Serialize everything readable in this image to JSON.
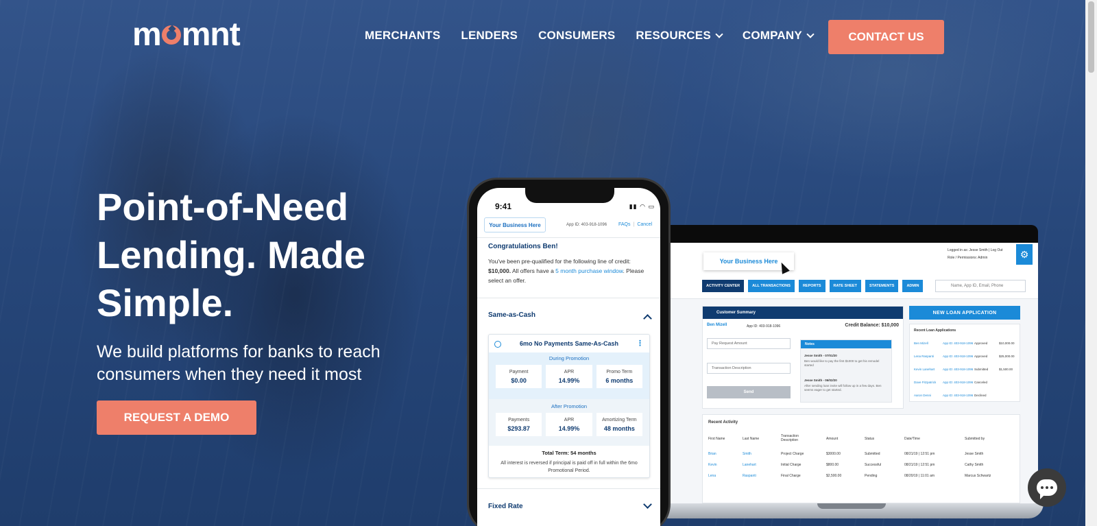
{
  "brand": {
    "logo_text": "momnt",
    "accent": "#ee7f6a",
    "navy": "#0f3b70",
    "blue": "#1b8ad8"
  },
  "nav": {
    "items": [
      {
        "label": "MERCHANTS",
        "dropdown": false
      },
      {
        "label": "LENDERS",
        "dropdown": false
      },
      {
        "label": "CONSUMERS",
        "dropdown": false
      },
      {
        "label": "RESOURCES",
        "dropdown": true
      },
      {
        "label": "COMPANY",
        "dropdown": true
      }
    ],
    "cta": "CONTACT US"
  },
  "hero": {
    "headline": "Point-of-Need Lending. Made Simple.",
    "subhead": "We build platforms for banks to reach consumers when they need it most",
    "cta": "REQUEST A DEMO"
  },
  "phone": {
    "time": "9:41",
    "business": "Your Business Here",
    "app_id": "App ID: 403-918-1096",
    "faqs": "FAQs",
    "cancel": "Cancel",
    "congrats": "Congratulations Ben!",
    "body_1": "You've been pre-qualified for the following line of credit:",
    "amount": "$10,000.",
    "body_2": "All offers have a",
    "window": "5 month purchase window",
    "body_3": ". Please select an offer.",
    "section_1": "Same-as-Cash",
    "offer_title": "6mo No Payments Same-As-Cash",
    "during_label": "During Promotion",
    "during": [
      {
        "label": "Payment",
        "value": "$0.00"
      },
      {
        "label": "APR",
        "value": "14.99%"
      },
      {
        "label": "Promo Term",
        "value": "6 months"
      }
    ],
    "after_label": "After Promotion",
    "after": [
      {
        "label": "Payments",
        "value": "$293.87"
      },
      {
        "label": "APR",
        "value": "14.99%"
      },
      {
        "label": "Amortizing Term",
        "value": "48 months"
      }
    ],
    "total_term": "Total Term: 54 months",
    "fine_print": "All interest is reversed if principal is paid off in full within the 6mo Promotional Period.",
    "section_2": "Fixed Rate"
  },
  "laptop": {
    "business": "Your Business Here",
    "logged_in": "Logged in as: Jesse Smith | Log Out",
    "role": "Role / Permissions: Admin",
    "tabs": [
      "ACTIVITY CENTER",
      "ALL TRANSACTIONS",
      "REPORTS",
      "RATE SHEET",
      "STATEMENTS",
      "ADMIN"
    ],
    "search_placeholder": "Name, App ID, Email, Phone",
    "customer_summary": "Customer Summary",
    "customer_name": "Ben Mizell",
    "customer_app": "App ID: 403-918-1096",
    "credit_balance": "Credit Balance: $10,000",
    "pay_request": "Pay Request Amount",
    "txn_desc": "Transaction Description",
    "send": "Send",
    "notes": "Notes",
    "note_1_head": "Jesse Smith - 07/01/20",
    "note_1": "Ben would like to pay the first $1000 to get his remodel started",
    "note_2_head": "Jesse Smith - 06/02/20",
    "note_2": "After sending loan invite will follow up in a few days. Ben seems eager to get started.",
    "new_loan": "NEW LOAN APPLICATION",
    "recent_loans": "Recent Loan Applications",
    "loans": [
      {
        "name": "Ben Mizell",
        "app": "App ID: 403-918-1096",
        "status": "Approved",
        "amount": "$10,000.00"
      },
      {
        "name": "Lena Raspanti",
        "app": "App ID: 403-918-1096",
        "status": "Approved",
        "amount": "$25,000.00"
      },
      {
        "name": "Kevin Lanehart",
        "app": "App ID: 403-918-1096",
        "status": "Submitted",
        "amount": "$1,500.00"
      },
      {
        "name": "Dave Fitzpatrick",
        "app": "App ID: 403-918-1096",
        "status": "Canceled",
        "amount": ""
      },
      {
        "name": "Aaron Denni",
        "app": "App ID: 403-918-1096",
        "status": "Declined",
        "amount": ""
      }
    ],
    "recent_activity": "Recent Activity",
    "activity_headers": [
      "First Name",
      "Last Name",
      "Transaction Description",
      "Amount",
      "Status",
      "Date/Time",
      "Submitted by"
    ],
    "activity": [
      [
        "Brian",
        "Smith",
        "Project Charge",
        "$3000.00",
        "Submitted",
        "08/21/19 | 12:51 pm",
        "Jesse Smith"
      ],
      [
        "Kevin",
        "Lanehart",
        "Initial Charge",
        "$800.00",
        "Successful",
        "08/21/19 | 12:51 pm",
        "Cathy Smith"
      ],
      [
        "Lena",
        "Raspanti",
        "Final Charge",
        "$2,500.00",
        "Pending",
        "08/20/19 | 11:01 am",
        "Marcus Schwartz"
      ]
    ]
  }
}
